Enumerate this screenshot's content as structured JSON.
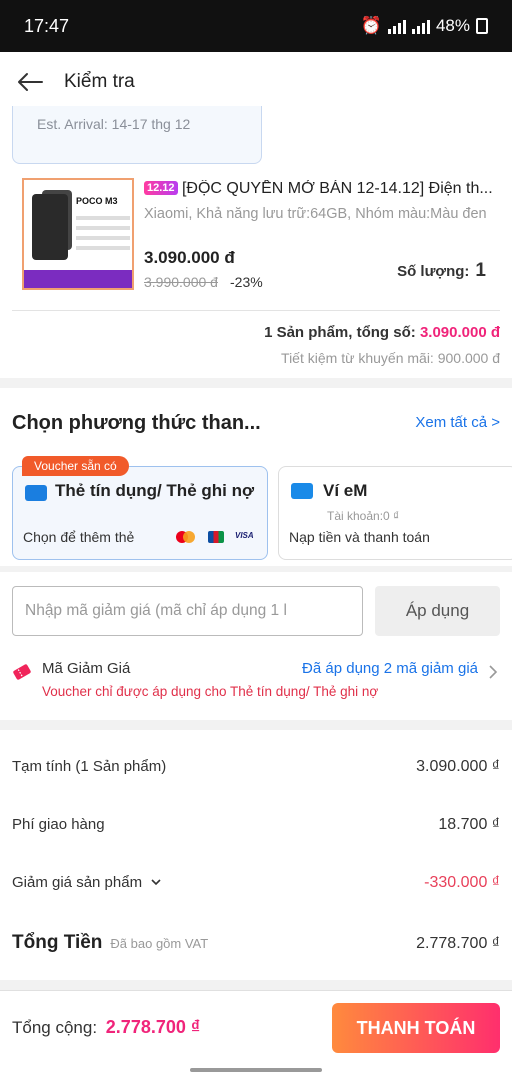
{
  "status_bar": {
    "time": "17:47",
    "battery": "48%"
  },
  "header": {
    "title": "Kiểm tra"
  },
  "shipping": {
    "arrival": "Est. Arrival: 14-17 thg 12"
  },
  "product": {
    "badge": "12.12",
    "name": "[ĐỘC QUYỀN MỞ BÁN 12-14.12] Điện th...",
    "variant": "Xiaomi, Khả năng lưu trữ:64GB, Nhóm màu:Màu đen",
    "price": "3.090.000 đ",
    "old_price": "3.990.000 đ",
    "discount": "-23%",
    "qty_label": "Số lượng:",
    "qty": "1",
    "thumb_brand": "POCO M3"
  },
  "summary": {
    "count_label": "1 Sản phẩm, tổng số:",
    "total": "3.090.000 đ",
    "saving": "Tiết kiệm từ khuyến mãi:  900.000 đ"
  },
  "payment": {
    "title": "Chọn phương thức than...",
    "see_all": "Xem tất cả >",
    "voucher_tag": "Voucher sẵn có",
    "card": {
      "title": "Thẻ tín dụng/ Thẻ ghi nợ",
      "sub": "Chọn để thêm thẻ"
    },
    "wallet": {
      "title": "Ví eM",
      "balance": "Tài khoản:0 ₫",
      "sub": "Nạp tiền và thanh toán"
    }
  },
  "promo": {
    "placeholder": "Nhập mã giảm giá (mã chỉ áp dụng 1 l",
    "apply": "Áp dụng",
    "voucher_label": "Mã Giảm Giá",
    "voucher_applied": "Đã áp dụng 2 mã giảm giá",
    "voucher_note": "Voucher chỉ được áp dụng cho Thẻ tín dụng/ Thẻ ghi nợ"
  },
  "breakdown": {
    "subtotal_label": "Tạm tính (1 Sản phẩm)",
    "subtotal": "3.090.000 ₫",
    "shipping_label": "Phí giao hàng",
    "shipping": "18.700 ₫",
    "discount_label": "Giảm giá sản phẩm",
    "discount": "-330.000 ₫",
    "total_label": "Tổng Tiền",
    "vat_note": "Đã bao gồm VAT",
    "total": "2.778.700 ₫"
  },
  "footer": {
    "grand_label": "Tổng cộng:",
    "grand_total": "2.778.700 ₫",
    "checkout": "THANH TOÁN"
  },
  "colors": {
    "accent_pink": "#f0247a",
    "link_blue": "#1a73e8",
    "checkout_start": "#ff8a3d",
    "checkout_end": "#ff2f6d"
  }
}
